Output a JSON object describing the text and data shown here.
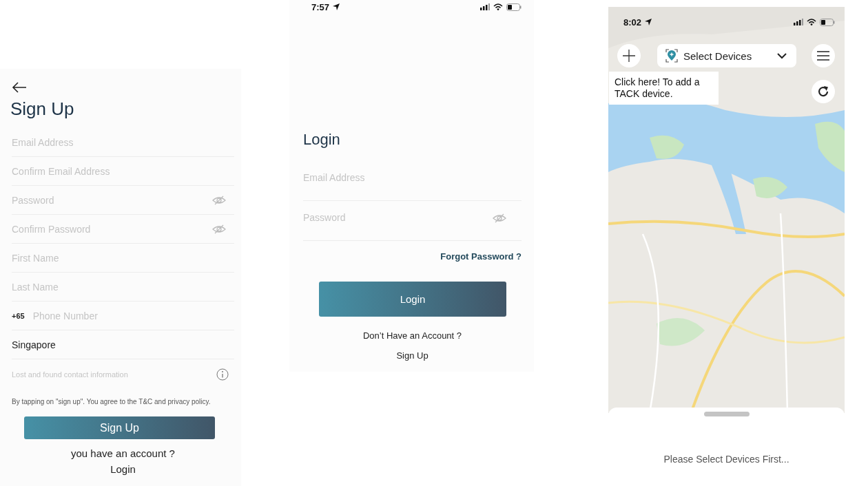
{
  "signup": {
    "title": "Sign Up",
    "fields": [
      {
        "kind": "text",
        "placeholder": "Email Address"
      },
      {
        "kind": "text",
        "placeholder": "Confirm Email Address"
      },
      {
        "kind": "password",
        "placeholder": "Password"
      },
      {
        "kind": "password",
        "placeholder": "Confirm Password"
      },
      {
        "kind": "text",
        "placeholder": "First Name"
      },
      {
        "kind": "text",
        "placeholder": "Last Name"
      },
      {
        "kind": "phone",
        "prefix": "+65",
        "placeholder": "Phone Number"
      },
      {
        "kind": "text",
        "value": "Singapore"
      },
      {
        "kind": "info",
        "placeholder": "Lost and found contact information"
      }
    ],
    "terms": "By tapping on \"sign up\". You agree to the T&C and privacy policy.",
    "button": "Sign Up",
    "account_prompt": "you have an account ?",
    "login_link": "Login"
  },
  "login": {
    "status_bar": {
      "time": "7:57"
    },
    "title": "Login",
    "fields": [
      {
        "kind": "text",
        "placeholder": "Email Address"
      },
      {
        "kind": "password",
        "placeholder": "Password"
      }
    ],
    "forgot_link": "Forgot Password ?",
    "button": "Login",
    "account_prompt": "Don’t Have an Account ?",
    "signup_link": "Sign Up"
  },
  "map_screen": {
    "status_bar": {
      "time": "8:02"
    },
    "device_select": "Select Devices",
    "tooltip": "Click here! To add a TACK device.",
    "message": "Please Select Devices First..."
  }
}
